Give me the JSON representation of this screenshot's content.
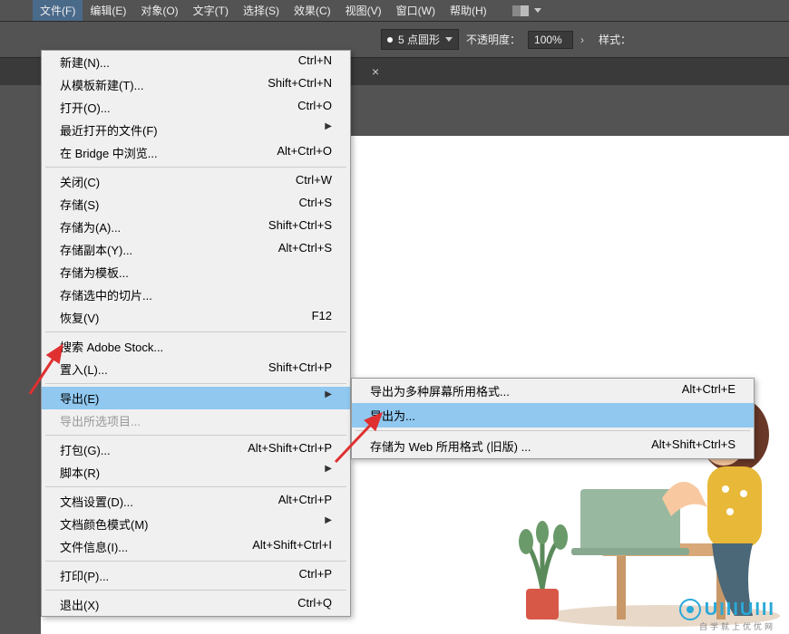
{
  "menubar": {
    "items": [
      {
        "label": "文件(F)",
        "key": "F",
        "active": true
      },
      {
        "label": "编辑(E)",
        "key": "E"
      },
      {
        "label": "对象(O)",
        "key": "O"
      },
      {
        "label": "文字(T)",
        "key": "T"
      },
      {
        "label": "选择(S)",
        "key": "S"
      },
      {
        "label": "效果(C)",
        "key": "C"
      },
      {
        "label": "视图(V)",
        "key": "V"
      },
      {
        "label": "窗口(W)",
        "key": "W"
      },
      {
        "label": "帮助(H)",
        "key": "H"
      }
    ]
  },
  "toolbar": {
    "brush_label": "5 点圆形",
    "opacity_label": "不透明度：",
    "opacity_value": "100%",
    "style_label": "样式："
  },
  "tab": {
    "close": "×"
  },
  "file_menu": {
    "sections": [
      [
        {
          "label": "新建(N)...",
          "shortcut": "Ctrl+N"
        },
        {
          "label": "从模板新建(T)...",
          "shortcut": "Shift+Ctrl+N"
        },
        {
          "label": "打开(O)...",
          "shortcut": "Ctrl+O"
        },
        {
          "label": "最近打开的文件(F)",
          "shortcut": "",
          "submenu": true
        },
        {
          "label": "在 Bridge 中浏览...",
          "shortcut": "Alt+Ctrl+O"
        }
      ],
      [
        {
          "label": "关闭(C)",
          "shortcut": "Ctrl+W"
        },
        {
          "label": "存储(S)",
          "shortcut": "Ctrl+S"
        },
        {
          "label": "存储为(A)...",
          "shortcut": "Shift+Ctrl+S"
        },
        {
          "label": "存储副本(Y)...",
          "shortcut": "Alt+Ctrl+S"
        },
        {
          "label": "存储为模板...",
          "shortcut": ""
        },
        {
          "label": "存储选中的切片...",
          "shortcut": ""
        },
        {
          "label": "恢复(V)",
          "shortcut": "F12"
        }
      ],
      [
        {
          "label": "搜索 Adobe Stock...",
          "shortcut": ""
        },
        {
          "label": "置入(L)...",
          "shortcut": "Shift+Ctrl+P"
        }
      ],
      [
        {
          "label": "导出(E)",
          "shortcut": "",
          "submenu": true,
          "highlight": true
        },
        {
          "label": "导出所选项目...",
          "shortcut": "",
          "disabled": true
        }
      ],
      [
        {
          "label": "打包(G)...",
          "shortcut": "Alt+Shift+Ctrl+P"
        },
        {
          "label": "脚本(R)",
          "shortcut": "",
          "submenu": true
        }
      ],
      [
        {
          "label": "文档设置(D)...",
          "shortcut": "Alt+Ctrl+P"
        },
        {
          "label": "文档颜色模式(M)",
          "shortcut": "",
          "submenu": true
        },
        {
          "label": "文件信息(I)...",
          "shortcut": "Alt+Shift+Ctrl+I"
        }
      ],
      [
        {
          "label": "打印(P)...",
          "shortcut": "Ctrl+P"
        }
      ],
      [
        {
          "label": "退出(X)",
          "shortcut": "Ctrl+Q"
        }
      ]
    ]
  },
  "export_submenu": {
    "items": [
      {
        "label": "导出为多种屏幕所用格式...",
        "shortcut": "Alt+Ctrl+E"
      },
      {
        "label": "导出为...",
        "shortcut": "",
        "highlight": true
      },
      {
        "label": "存储为 Web 所用格式 (旧版) ...",
        "shortcut": "Alt+Shift+Ctrl+S"
      }
    ]
  },
  "watermark": {
    "text": "UIIIUIII",
    "sub": "自学就上优优网"
  }
}
